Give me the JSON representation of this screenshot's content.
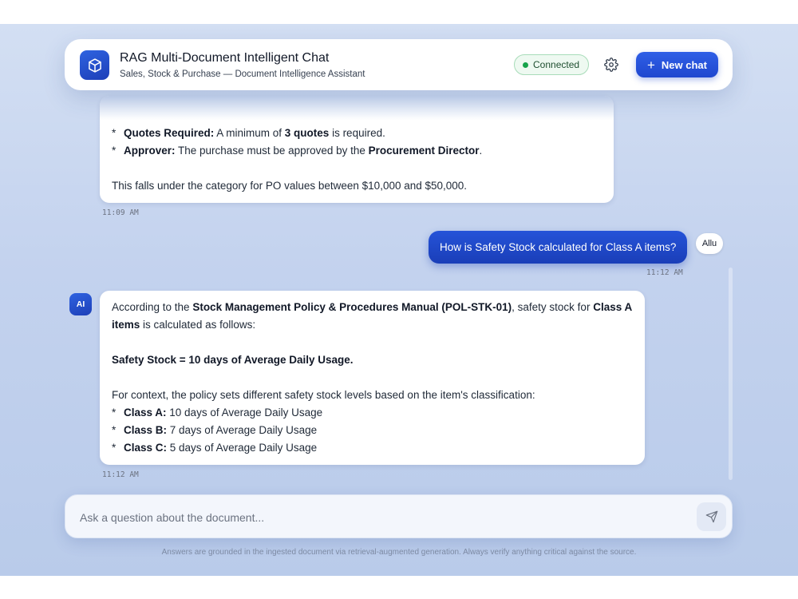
{
  "header": {
    "title": "RAG Multi-Document Intelligent Chat",
    "subtitle": "Sales, Stock & Purchase — Document Intelligence Assistant",
    "status": "Connected",
    "new_chat_label": "New chat",
    "icons": {
      "logo": "cube-icon",
      "settings": "gear-icon",
      "add": "plus-icon"
    },
    "colors": {
      "accent": "#1f47cf",
      "status_green": "#16a34a"
    }
  },
  "messages": [
    {
      "role": "assistant",
      "bullets": [
        {
          "bold": "Quotes Required:",
          "text_a": " A minimum of ",
          "bold_b": "3 quotes",
          "text_b": " is required."
        },
        {
          "bold": "Approver:",
          "text_a": " The purchase must be approved by the ",
          "bold_b": "Procurement Director",
          "text_b": "."
        }
      ],
      "closing": "This falls under the category for PO values between $10,000 and $50,000.",
      "time": "11:09 AM"
    },
    {
      "role": "user",
      "avatar": "Allu",
      "text": "How is Safety Stock calculated for Class A items?",
      "time": "11:12 AM"
    },
    {
      "role": "assistant",
      "avatar": "AI",
      "intro_a": "According to the ",
      "intro_bold": "Stock Management Policy & Procedures Manual (POL-STK-01)",
      "intro_b": ", safety stock for ",
      "intro_bold_2": "Class A items",
      "intro_c": " is calculated as follows:",
      "formula": "Safety Stock = 10 days of Average Daily Usage.",
      "context": "For context, the policy sets different safety stock levels based on the item's classification:",
      "bullets": [
        {
          "bold": "Class A:",
          "text": " 10 days of Average Daily Usage"
        },
        {
          "bold": "Class B:",
          "text": " 7 days of Average Daily Usage"
        },
        {
          "bold": "Class C:",
          "text": " 5 days of Average Daily Usage"
        }
      ],
      "time": "11:12 AM"
    }
  ],
  "composer": {
    "placeholder": "Ask a question about the document...",
    "send_icon": "send-icon"
  },
  "footer_note": "Answers are grounded in the ingested document via retrieval-augmented generation. Always verify anything critical against the source."
}
